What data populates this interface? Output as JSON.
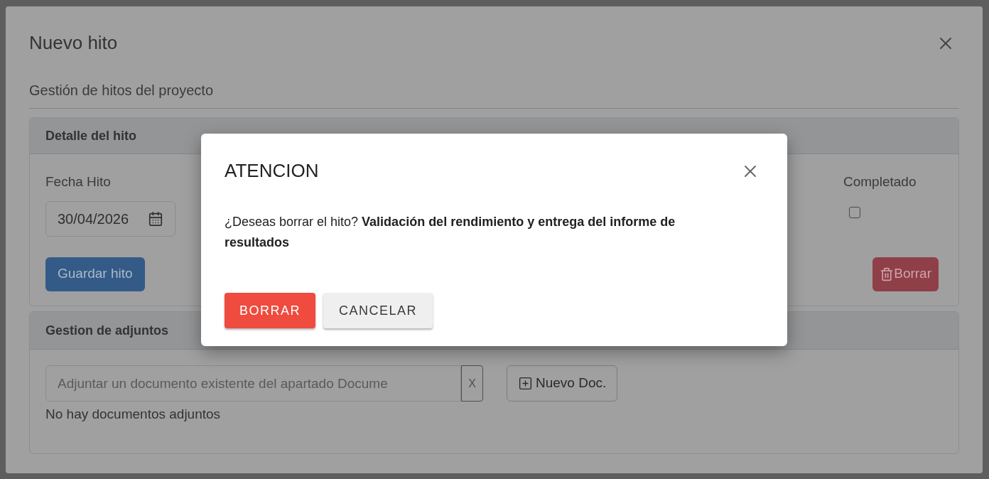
{
  "dialog": {
    "title": "Nuevo hito",
    "subtitle": "Gestión de hitos del proyecto",
    "detail_card": {
      "title": "Detalle del hito",
      "fields": [
        {
          "kind": "date",
          "label": "Fecha Hito",
          "value": "30/04/2026"
        },
        {
          "kind": "checkbox",
          "label": "Completado",
          "checked": false
        }
      ],
      "buttons": [
        {
          "kind": "save",
          "label": "Guardar hito"
        },
        {
          "kind": "delete",
          "label": "Borrar"
        }
      ]
    },
    "attachments_card": {
      "title": "Gestion de adjuntos",
      "search": {
        "placeholder": "Adjuntar un documento existente del apartado Docume"
      },
      "clear_label": "X",
      "new_button": "Nuevo Doc.",
      "empty_text": "No hay documentos adjuntos"
    }
  },
  "alert": {
    "title": "ATENCION",
    "message": "¿Deseas borrar el hito? **Validación del rendimiento y entrega del informe de resultados**",
    "buttons": [
      {
        "kind": "danger",
        "label": "BORRAR"
      },
      {
        "kind": "secondary",
        "label": "CANCELAR"
      }
    ]
  }
}
